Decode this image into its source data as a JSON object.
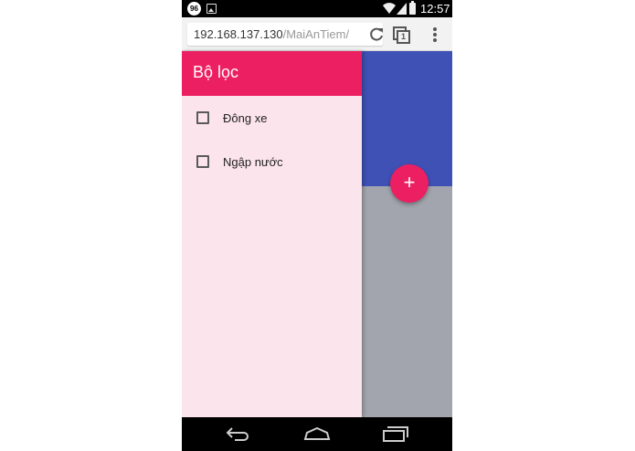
{
  "status_bar": {
    "notification_badge": "96",
    "clock": "12:57",
    "icons": [
      "image-icon",
      "wifi-icon",
      "signal-icon",
      "battery-icon"
    ]
  },
  "browser": {
    "url_host": "192.168.137.130",
    "url_path": "/MaiAnTiem/",
    "tab_count": "1",
    "icons": [
      "reload-icon",
      "tabs-icon",
      "overflow-menu-icon"
    ]
  },
  "drawer": {
    "title": "Bộ lọc",
    "items": [
      {
        "label": "Đông xe",
        "checked": false
      },
      {
        "label": "Ngập nước",
        "checked": false
      }
    ]
  },
  "fab": {
    "label": "+"
  },
  "colors": {
    "primary": "#3f51b5",
    "accent": "#ec1f63",
    "drawer_bg": "#fce4ec",
    "scrim": "#a3a5ae"
  },
  "nav_bar": {
    "icons": [
      "back-icon",
      "home-icon",
      "recents-icon"
    ]
  }
}
